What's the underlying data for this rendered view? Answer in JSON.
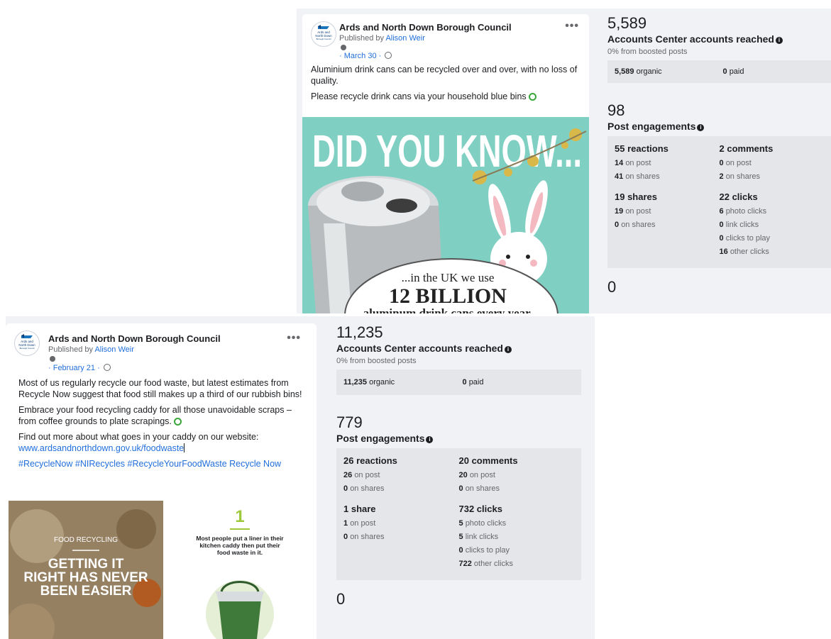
{
  "top": {
    "post": {
      "page_name": "Ards and North Down Borough Council",
      "avatar_text": [
        "Ards and",
        "North Down",
        "Borough Council"
      ],
      "published_prefix": "Published by",
      "author": "Alison Weir",
      "date": "· March 30 ·",
      "paragraphs": [
        "Aluminium drink cans can be recycled over and over, with no loss of quality.",
        "Please recycle drink cans via your household blue bins"
      ],
      "image": {
        "headline": "DID YOU KNOW...",
        "line1": "...in the UK we use",
        "line2": "12 BILLION",
        "line3": "aluminum drink cans every year."
      }
    },
    "reach": {
      "value": "5,589",
      "label": "Accounts Center accounts reached",
      "sub": "0% from boosted posts",
      "organic_num": "5,589",
      "organic_word": "organic",
      "paid_num": "0",
      "paid_word": "paid"
    },
    "engagement": {
      "value": "98",
      "label": "Post engagements",
      "reactions": {
        "title": "55 reactions",
        "lines": [
          [
            "14",
            "on post"
          ],
          [
            "41",
            "on shares"
          ]
        ]
      },
      "comments": {
        "title": "2 comments",
        "lines": [
          [
            "0",
            "on post"
          ],
          [
            "2",
            "on shares"
          ]
        ]
      },
      "shares": {
        "title": "19 shares",
        "lines": [
          [
            "19",
            "on post"
          ],
          [
            "0",
            "on shares"
          ]
        ]
      },
      "clicks": {
        "title": "22 clicks",
        "lines": [
          [
            "6",
            "photo clicks"
          ],
          [
            "0",
            "link clicks"
          ],
          [
            "0",
            "clicks to play"
          ],
          [
            "16",
            "other clicks"
          ]
        ]
      }
    },
    "next_value": "0"
  },
  "bottom": {
    "post": {
      "page_name": "Ards and North Down Borough Council",
      "avatar_text": [
        "Ards and",
        "North Down",
        "Borough Council"
      ],
      "published_prefix": "Published by",
      "author": "Alison Weir",
      "date": "· February 21 ·",
      "paragraphs": [
        "Most of us regularly recycle our food waste, but latest estimates from Recycle Now suggest that food still makes up a third of our rubbish bins!",
        "Embrace your food recycling caddy for all those unavoidable scraps – from coffee grounds to plate scrapings.",
        "Find out more about what goes in your caddy on our website:"
      ],
      "link": "www.ardsandnorthdown.gov.uk/foodwaste",
      "hashtags": "#RecycleNow #NIRecycles #RecycleYourFoodWaste Recycle Now",
      "image": {
        "tag": "FOOD RECYCLING",
        "headline_1": "GETTING IT",
        "headline_2": "RIGHT HAS NEVER",
        "headline_3": "BEEN EASIER",
        "step_num": "1",
        "step_text": "Most people put a liner in their kitchen caddy then put their food waste in it."
      }
    },
    "reach": {
      "value": "11,235",
      "label": "Accounts Center accounts reached",
      "sub": "0% from boosted posts",
      "organic_num": "11,235",
      "organic_word": "organic",
      "paid_num": "0",
      "paid_word": "paid"
    },
    "engagement": {
      "value": "779",
      "label": "Post engagements",
      "reactions": {
        "title": "26 reactions",
        "lines": [
          [
            "26",
            "on post"
          ],
          [
            "0",
            "on shares"
          ]
        ]
      },
      "comments": {
        "title": "20 comments",
        "lines": [
          [
            "20",
            "on post"
          ],
          [
            "0",
            "on shares"
          ]
        ]
      },
      "shares": {
        "title": "1 share",
        "lines": [
          [
            "1",
            "on post"
          ],
          [
            "0",
            "on shares"
          ]
        ]
      },
      "clicks": {
        "title": "732 clicks",
        "lines": [
          [
            "5",
            "photo clicks"
          ],
          [
            "5",
            "link clicks"
          ],
          [
            "0",
            "clicks to play"
          ],
          [
            "722",
            "other clicks"
          ]
        ]
      }
    },
    "next_value": "0"
  },
  "colors": {
    "link": "#216fdb",
    "metric_box": "#e4e6ea",
    "teal": "#7fcfc3",
    "caddy_green": "#3f7a3a"
  }
}
